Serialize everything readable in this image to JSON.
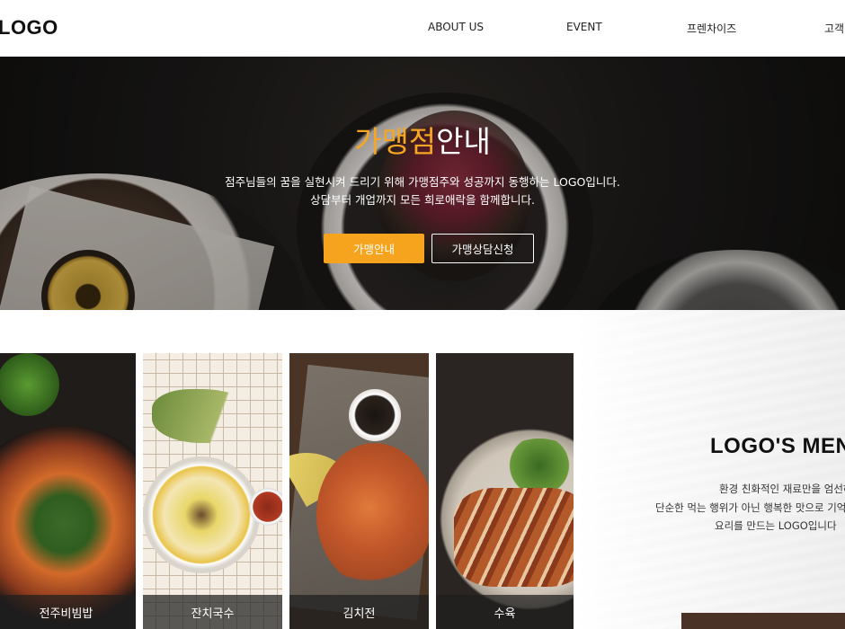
{
  "header": {
    "logo": "LOGO",
    "nav": [
      "ABOUT US",
      "EVENT",
      "프렌차이즈",
      "고객센터"
    ]
  },
  "hero": {
    "title_accent": "가맹점",
    "title_rest": "안내",
    "desc_line1": "점주님들의 꿈을 실현시켜 드리기 위해 가맹점주와 성공까지 동행하는 LOGO입니다.",
    "desc_line2": "상담부터 개업까지 모든 희로애락을 함께합니다.",
    "btn_primary": "가맹안내",
    "btn_outline": "가맹상담신청",
    "accent_color": "#f6a41d"
  },
  "menu": {
    "cards": [
      {
        "label": "전주비빔밥"
      },
      {
        "label": "잔치국수"
      },
      {
        "label": "김치전"
      },
      {
        "label": "수육"
      }
    ],
    "title": "LOGO'S MENU",
    "desc_line1": "환경 친화적인 재료만을 엄선하여",
    "desc_line2": "단순한 먹는 행위가 아닌 행복한 맛으로 기억되는",
    "desc_line3": "요리를 만드는 LOGO입니다"
  }
}
